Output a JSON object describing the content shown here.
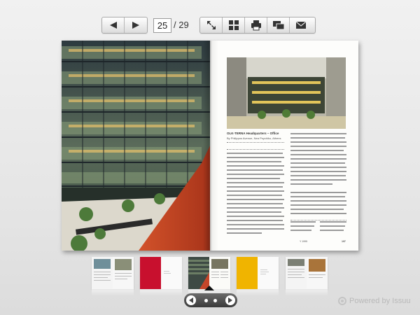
{
  "toolbar": {
    "prev_icon": "arrow-left-icon",
    "next_icon": "arrow-right-icon",
    "current_page": "25",
    "total_pages": "/ 29",
    "tools": [
      {
        "name": "fullscreen-icon"
      },
      {
        "name": "grid-icon"
      },
      {
        "name": "print-icon"
      },
      {
        "name": "share-icon"
      },
      {
        "name": "email-icon"
      }
    ]
  },
  "article": {
    "title": "OLK-TERNA Headquarters – Office",
    "subtitle": "By Philippos Avenue, Nea Psychiko, Athens",
    "page_number": "197",
    "footer_left": "Y 1995"
  },
  "colors": {
    "accent_red": "#c8102e",
    "thumb_red": "#c8102e",
    "thumb_yellow": "#f0b400"
  },
  "powered_by": "Powered by Issuu",
  "pager": {
    "prev_icon": "chevron-left-icon",
    "next_icon": "chevron-right-icon"
  }
}
